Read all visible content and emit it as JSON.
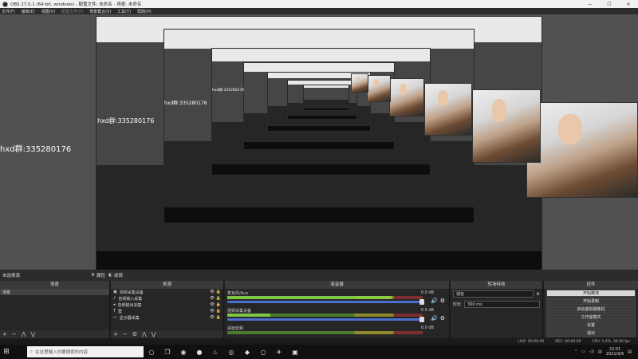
{
  "window": {
    "title": "OBS 27.0.1 (64-bit, windows) - 配置文件: 未命名 - 场景: 未命名"
  },
  "menu": [
    "文件(F)",
    "编辑(E)",
    "视图(V)",
    "配置文件(P)",
    "场景集合(S)",
    "工具(T)",
    "帮助(H)"
  ],
  "preview": {
    "overlay_texts": [
      "hxd群:335280176",
      "hxd群:335280176",
      "hxd群:335280176",
      "hxd群:335280176"
    ]
  },
  "scene_bar": {
    "current_scene": "未选择源",
    "properties_label": "属性",
    "filters_label": "滤镜"
  },
  "scenes": {
    "title": "场景",
    "items": [
      "场景"
    ]
  },
  "sources": {
    "title": "来源",
    "items": [
      {
        "label": "视频采集设备",
        "icon": "camera-icon"
      },
      {
        "label": "音频输入采集",
        "icon": "mic-icon"
      },
      {
        "label": "音频输出采集",
        "icon": "speaker-icon"
      },
      {
        "label": "群",
        "icon": "text-icon"
      },
      {
        "label": "显示器采集",
        "icon": "monitor-icon"
      }
    ]
  },
  "mixer": {
    "title": "混音器",
    "channels": [
      {
        "name": "麦克风/Aux",
        "db": "0.0 dB",
        "level": 0.84
      },
      {
        "name": "视频采集设备",
        "db": "0.0 dB",
        "level": 0.22
      },
      {
        "name": "桌面音频",
        "db": "0.0 dB",
        "level": 0.0
      }
    ]
  },
  "transitions": {
    "title": "转场特效",
    "type": "褪色",
    "duration_label": "时长",
    "duration_value": "300 ms"
  },
  "controls": {
    "title": "控件",
    "buttons": [
      "开始推流",
      "开始录制",
      "启动虚拟摄像机",
      "工作室模式",
      "设置",
      "退出"
    ]
  },
  "status": {
    "live": "LIVE: 00:00:00",
    "rec": "REC: 00:00:00",
    "cpu": "CPU: 1.6%, 30.00 fps"
  },
  "taskbar": {
    "search_placeholder": "在这里输入你要搜索的内容",
    "time": "22:01",
    "date": "2021/9/6"
  }
}
